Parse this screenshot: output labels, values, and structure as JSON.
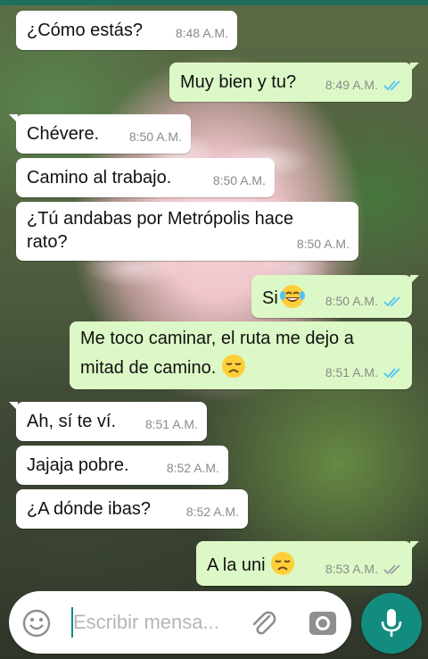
{
  "messages": [
    {
      "text": "¿Cómo estás?",
      "time": "8:48 A.M."
    },
    {
      "text": "Muy bien y tu?",
      "time": "8:49 A.M."
    },
    {
      "text": "Chévere.",
      "time": "8:50 A.M."
    },
    {
      "text": "Camino al trabajo.",
      "time": "8:50 A.M."
    },
    {
      "text_line1": "¿Tú andabas por Metrópolis hace",
      "text_line2": "rato?",
      "time": "8:50 A.M."
    },
    {
      "text": "Si",
      "time": "8:50 A.M."
    },
    {
      "text_line1": "Me toco caminar, el ruta me dejo a",
      "text_line2": "mitad de camino.",
      "time": "8:51 A.M."
    },
    {
      "text": "Ah, sí te ví.",
      "time": "8:51 A.M."
    },
    {
      "text": "Jajaja pobre.",
      "time": "8:52 A.M."
    },
    {
      "text": "¿A dónde ibas?",
      "time": "8:52 A.M."
    },
    {
      "text": "A la uni",
      "time": "8:53 A.M."
    }
  ],
  "composer": {
    "placeholder": "Escribir mensa...",
    "icons": [
      "emoji-icon",
      "attach-icon",
      "camera-icon",
      "microphone-icon"
    ]
  },
  "colors": {
    "incoming_bubble": "#ffffff",
    "outgoing_bubble": "#dcf8c6",
    "accent": "#128c7e",
    "read_tick": "#4fc3f7",
    "delivered_tick": "#9e9e9e"
  },
  "ticks": {
    "read": "read-ticks-icon",
    "delivered": "delivered-ticks-icon"
  }
}
